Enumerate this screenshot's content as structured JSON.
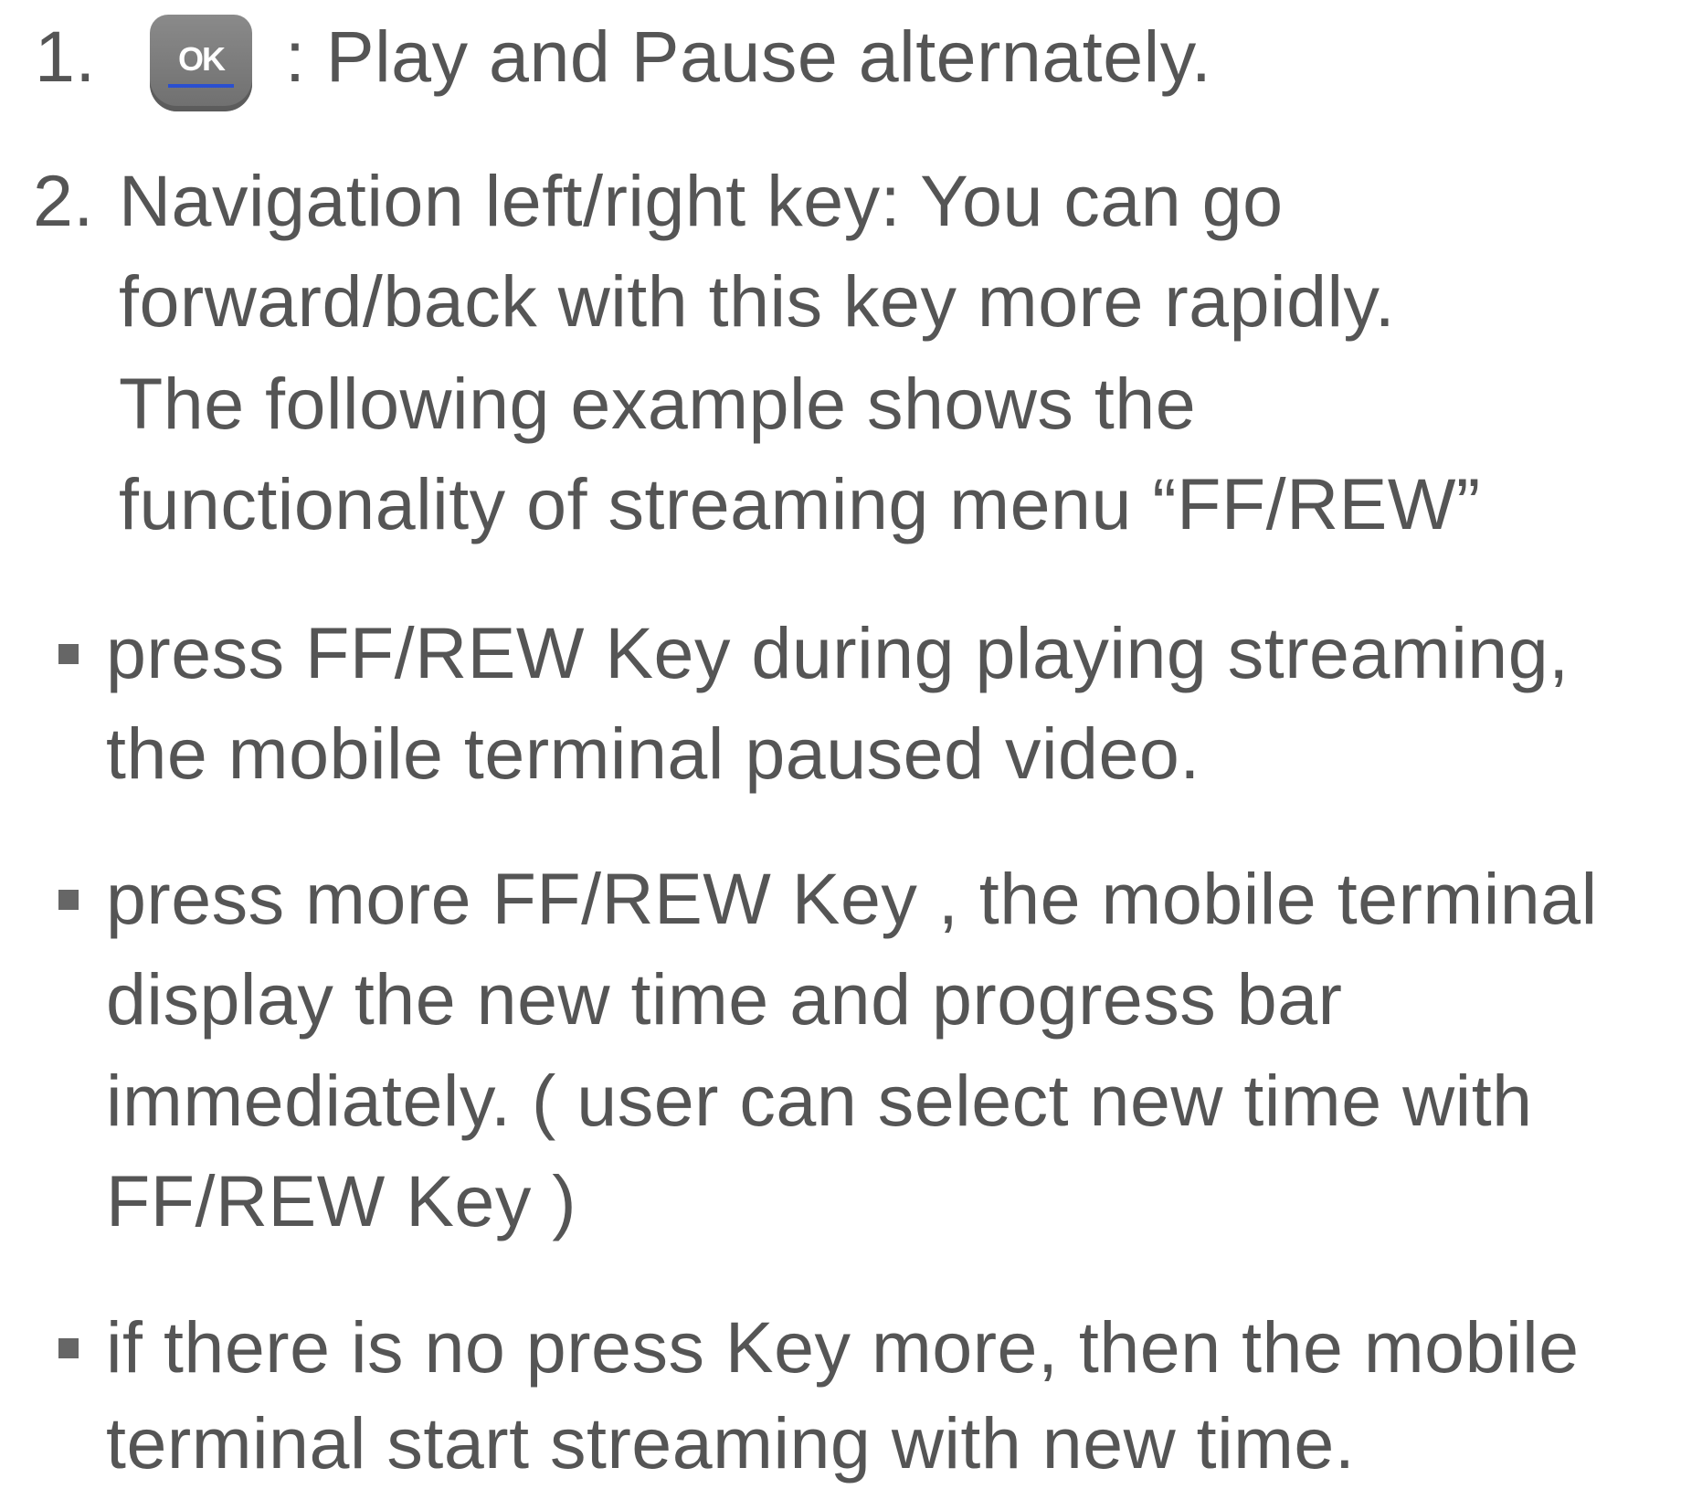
{
  "items": [
    {
      "number": "1.",
      "key_label": "OK",
      "text": ": Play and Pause alternately."
    },
    {
      "number": "2.",
      "lines": [
        "Navigation left/right key: You can go",
        "forward/back with this key more rapidly.",
        "The following example shows the",
        "functionality of streaming menu “FF/REW”"
      ]
    }
  ],
  "bullets": [
    {
      "lines": [
        "press FF/REW Key during playing streaming,",
        "the mobile terminal paused video."
      ]
    },
    {
      "lines": [
        "press more FF/REW Key , the mobile terminal",
        "display the new time and progress bar",
        "immediately. ( user can select new time with",
        "FF/REW Key )"
      ]
    },
    {
      "lines": [
        "if there is no press Key more, then the mobile",
        "terminal start streaming with new time."
      ]
    }
  ]
}
